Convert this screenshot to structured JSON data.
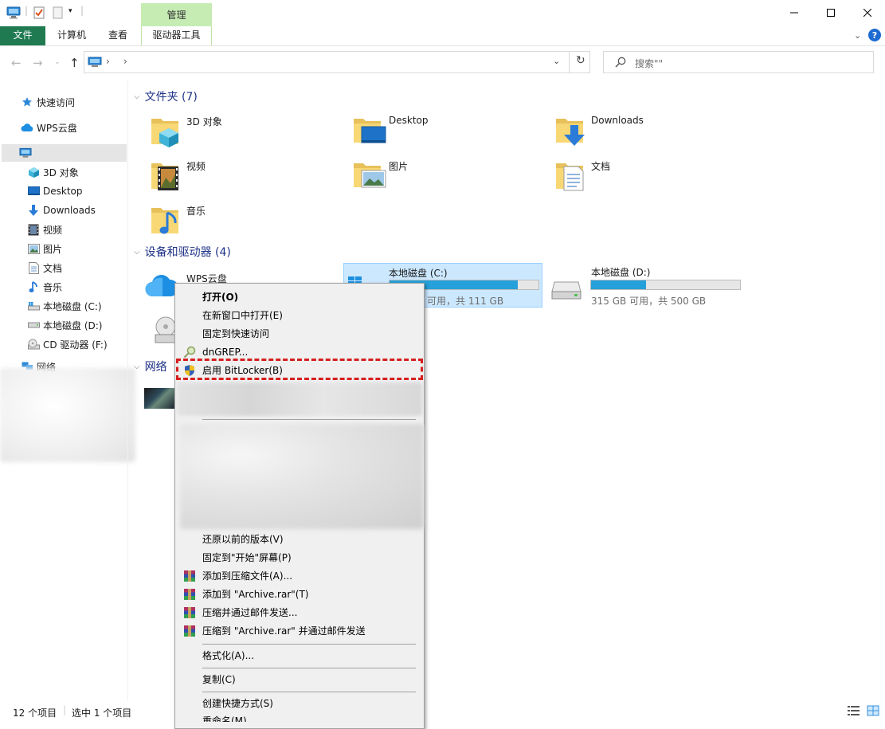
{
  "ribbon": {
    "manage_label": "管理",
    "tabs": [
      "文件",
      "计算机",
      "查看",
      "驱动器工具"
    ]
  },
  "address": {
    "search_placeholder": "搜索\"\""
  },
  "sidebar": {
    "quick_access": "快速访问",
    "wps_cloud": "WPS云盘",
    "items": [
      "3D 对象",
      "Desktop",
      "Downloads",
      "视频",
      "图片",
      "文档",
      "音乐",
      "本地磁盘 (C:)",
      "本地磁盘 (D:)",
      "CD 驱动器 (F:)"
    ],
    "network": "网络"
  },
  "main": {
    "folders_header": "文件夹 (7)",
    "folders": [
      "3D 对象",
      "Desktop",
      "Downloads",
      "视频",
      "图片",
      "文档",
      "音乐"
    ],
    "devices_header": "设备和驱动器 (4)",
    "wps_cloud": "WPS云盘",
    "drive_c": {
      "label": "本地磁盘 (C:)",
      "free_text": "可用，共 111 GB",
      "used_fraction": 0.86
    },
    "drive_d": {
      "label": "本地磁盘 (D:)",
      "free_text": "315 GB 可用，共 500 GB",
      "used_fraction": 0.37
    },
    "network_header": "网络"
  },
  "context_menu": {
    "items": [
      "打开(O)",
      "在新窗口中打开(E)",
      "固定到快速访问",
      "dnGREP...",
      "启用 BitLocker(B)",
      "还原以前的版本(V)",
      "固定到\"开始\"屏幕(P)",
      "添加到压缩文件(A)...",
      "添加到 \"Archive.rar\"(T)",
      "压缩并通过邮件发送...",
      "压缩到 \"Archive.rar\" 并通过邮件发送",
      "格式化(A)...",
      "复制(C)",
      "创建快捷方式(S)",
      "重命名(M)"
    ]
  },
  "status": {
    "count": "12 个项目",
    "selected": "选中 1 个项目"
  },
  "colors": {
    "accent": "#1f7a52",
    "manage_tab": "#c6ecb4",
    "drive_bar": "#26a0da",
    "selection": "#cce8ff",
    "highlight_box": "#d61f1f"
  }
}
